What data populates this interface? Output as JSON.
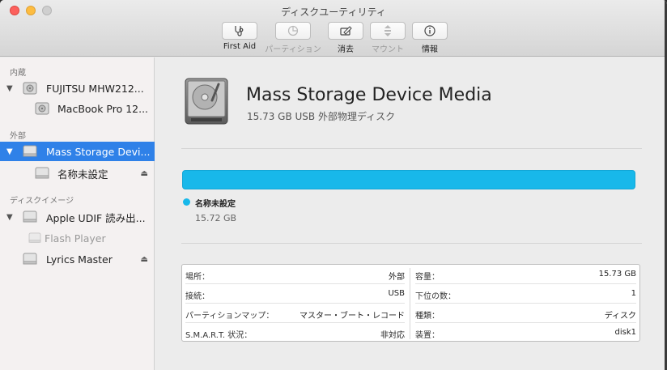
{
  "window": {
    "title": "ディスクユーティリティ"
  },
  "toolbar": {
    "first_aid": "First Aid",
    "partition": "パーティション",
    "erase": "消去",
    "mount": "マウント",
    "info": "情報"
  },
  "sidebar": {
    "section_internal": "内蔵",
    "section_external": "外部",
    "section_images": "ディスクイメージ",
    "items": [
      {
        "label": "FUJITSU MHW212..."
      },
      {
        "label": "MacBook Pro 12..."
      },
      {
        "label": "Mass Storage Devi..."
      },
      {
        "label": "名称未設定"
      },
      {
        "label": "Apple UDIF 読み出..."
      },
      {
        "label": "Flash Player"
      },
      {
        "label": "Lyrics Master"
      }
    ]
  },
  "device": {
    "name": "Mass Storage Device Media",
    "subtitle": "15.73 GB USB 外部物理ディスク"
  },
  "usage": {
    "fill_fraction": 1.0,
    "color": "#18b8ea",
    "volume_name": "名称未設定",
    "volume_size": "15.72 GB"
  },
  "info": {
    "left": [
      {
        "key": "場所：",
        "value": "外部"
      },
      {
        "key": "接続：",
        "value": "USB"
      },
      {
        "key": "パーティションマップ：",
        "value": "マスター・ブート・レコード"
      },
      {
        "key": "S.M.A.R.T. 状況：",
        "value": "非対応"
      }
    ],
    "right": [
      {
        "key": "容量：",
        "value": "15.73 GB"
      },
      {
        "key": "下位の数：",
        "value": "1"
      },
      {
        "key": "種類：",
        "value": "ディスク"
      },
      {
        "key": "装置：",
        "value": "disk1"
      }
    ]
  },
  "icons": {
    "first_aid": "stethoscope-icon",
    "partition": "pie-chart-icon",
    "erase": "erase-disk-icon",
    "mount": "mount-arrows-icon",
    "info": "info-icon",
    "disk": "hard-disk-icon",
    "eject": "eject-icon"
  }
}
